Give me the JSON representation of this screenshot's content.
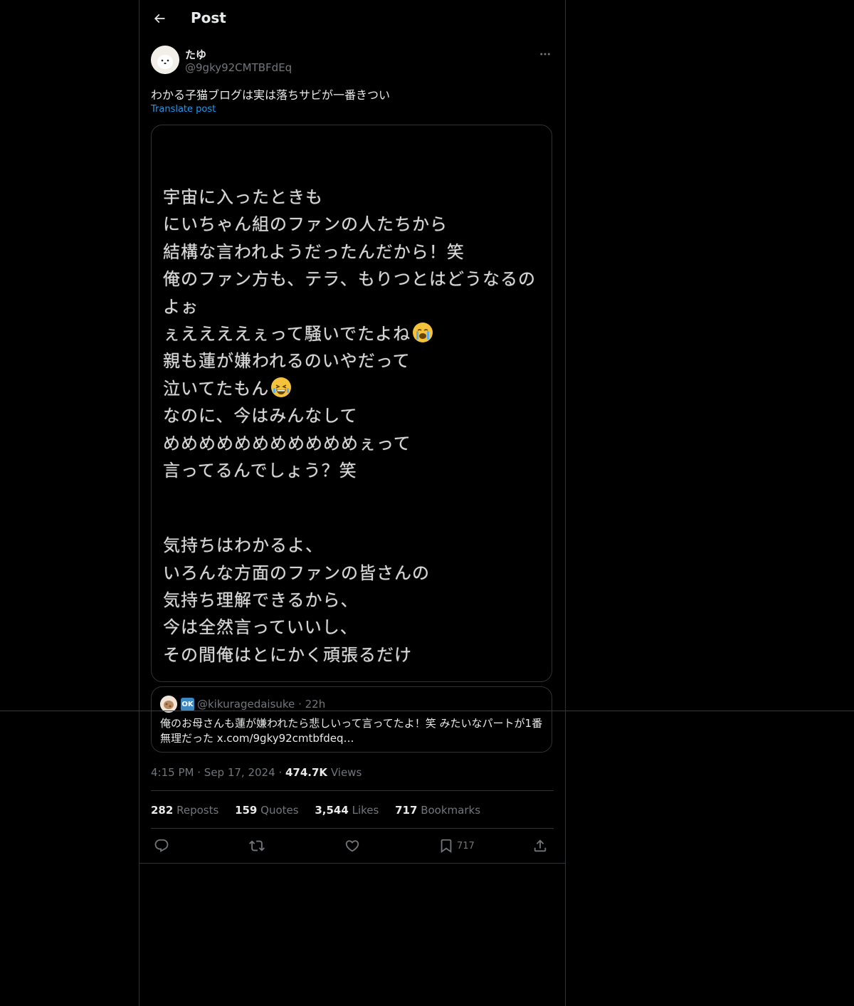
{
  "header": {
    "title": "Post"
  },
  "post": {
    "display_name": "たゆ",
    "handle": "@9gky92CMTBFdEq",
    "text": "わかる子猫ブログは実は落ちサビが一番きつい",
    "translate_label": "Translate post",
    "media_lines": [
      "宇宙に入ったときも",
      "にいちゃん組のファンの人たちから",
      "結構な言われようだったんだから！笑",
      "俺のファン方も、テラ、もりつとはどうなるの",
      "よぉ",
      "ぇええええぇって騒いでたよね",
      "親も蓮が嫌われるのいやだって",
      "泣いてたもん",
      "なのに、今はみんなして",
      "めめめめめめめめめめめぇって",
      "言ってるんでしょう？笑",
      "気持ちはわかるよ、",
      "いろんな方面のファンの皆さんの",
      "気持ち理解できるから、",
      "今は全然言っていいし、",
      "その間俺はとにかく頑張るだけ"
    ],
    "quote": {
      "badge": "OK",
      "handle": "@kikuragedaisuke",
      "separator": "·",
      "time": "22h",
      "text": "俺のお母さんも蓮が嫌われたら悲しいって言ってたよ！笑 みたいなパートが1番無理だった x.com/9gky92cmtbfdeq…"
    },
    "time": "4:15 PM",
    "dot": "·",
    "date": "Sep 17, 2024",
    "views_count": "474.7K",
    "views_label": "Views",
    "stats": {
      "reposts_count": "282",
      "reposts_label": "Reposts",
      "quotes_count": "159",
      "quotes_label": "Quotes",
      "likes_count": "3,544",
      "likes_label": "Likes",
      "bookmarks_count": "717",
      "bookmarks_label": "Bookmarks"
    },
    "actions": {
      "bookmark_count": "717"
    }
  },
  "colors": {
    "background": "#000000",
    "text": "#e7e9ea",
    "muted": "#71767b",
    "link": "#1d9bf0",
    "border": "#2f3336",
    "ok_badge": "#3b88c3"
  },
  "icons": [
    "back-arrow-icon",
    "more-icon",
    "reply-icon",
    "repost-icon",
    "like-icon",
    "bookmark-icon",
    "share-icon",
    "crying-face-emoji",
    "laughing-face-emoji"
  ]
}
